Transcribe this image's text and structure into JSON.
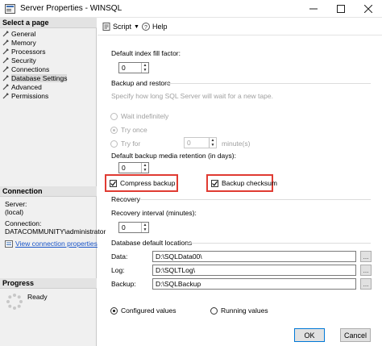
{
  "window": {
    "title": "Server Properties - WINSQL"
  },
  "left_pane": {
    "select_page_header": "Select a page",
    "pages": [
      {
        "label": "General"
      },
      {
        "label": "Memory"
      },
      {
        "label": "Processors"
      },
      {
        "label": "Security"
      },
      {
        "label": "Connections"
      },
      {
        "label": "Database Settings"
      },
      {
        "label": "Advanced"
      },
      {
        "label": "Permissions"
      }
    ],
    "connection_header": "Connection",
    "server_label": "Server:",
    "server_value": "(local)",
    "connection_label": "Connection:",
    "connection_value": "DATACOMMUNITY\\administrator",
    "view_connection_link": "View connection properties",
    "progress_header": "Progress",
    "progress_status": "Ready"
  },
  "toolbar": {
    "script_label": "Script",
    "help_label": "Help"
  },
  "settings": {
    "fill_factor_label": "Default index fill factor:",
    "fill_factor_value": "0",
    "backup_restore_title": "Backup and restore",
    "backup_restore_hint": "Specify how long SQL Server will wait for a new tape.",
    "wait_indefinitely": "Wait indefinitely",
    "try_once": "Try once",
    "try_for": "Try for",
    "try_for_value": "0",
    "minutes_label": "minute(s)",
    "retention_label": "Default backup media retention (in days):",
    "retention_value": "0",
    "compress_backup": "Compress backup",
    "backup_checksum": "Backup checksum",
    "recovery_title": "Recovery",
    "recovery_interval_label": "Recovery interval (minutes):",
    "recovery_interval_value": "0",
    "db_locations_title": "Database default locations",
    "data_label": "Data:",
    "data_value": "D:\\SQLData00\\",
    "log_label": "Log:",
    "log_value": "D:\\SQLTLog\\",
    "backup_label": "Backup:",
    "backup_value": "D:\\SQLBackup",
    "browse_label": "...",
    "configured_values": "Configured values",
    "running_values": "Running values"
  },
  "buttons": {
    "ok": "OK",
    "cancel": "Cancel"
  },
  "colors": {
    "highlight": "#e03b32",
    "link": "#1a55c8"
  }
}
